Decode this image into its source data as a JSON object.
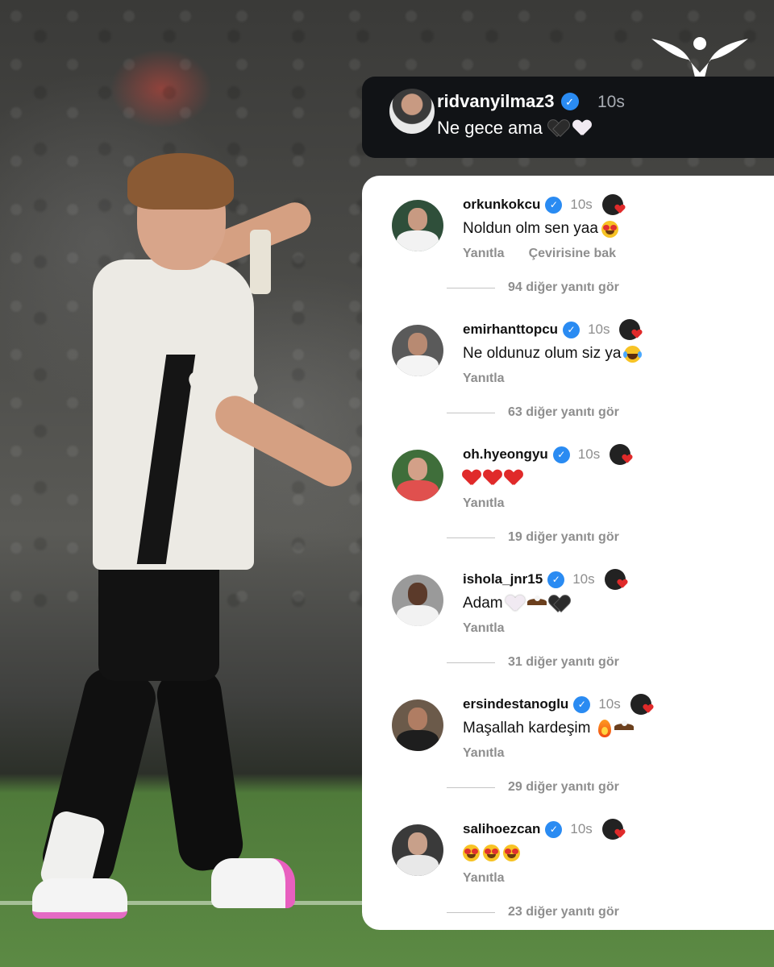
{
  "post": {
    "username": "ridvanyilmaz3",
    "time": "10s",
    "text": "Ne gece ama"
  },
  "actions": {
    "reply": "Yanıtla",
    "translate": "Çevirisine bak"
  },
  "comments": [
    {
      "username": "orkunkokcu",
      "time": "10s",
      "text": "Noldun olm sen yaa",
      "more": "94 diğer yanıtı gör",
      "avatar_colors": [
        "#c89a82",
        "#f2f2f2",
        "#2f4f3a"
      ]
    },
    {
      "username": "emirhanttopcu",
      "time": "10s",
      "text": "Ne oldunuz olum siz ya",
      "more": "63 diğer yanıtı gör",
      "avatar_colors": [
        "#b88a72",
        "#f4f4f4",
        "#5a5a5a"
      ]
    },
    {
      "username": "oh.hyeongyu",
      "time": "10s",
      "text": "",
      "more": "19 diğer yanıtı gör",
      "avatar_colors": [
        "#d3a088",
        "#e0504e",
        "#3f6e3a"
      ]
    },
    {
      "username": "ishola_jnr15",
      "time": "10s",
      "text": "Adam",
      "more": "31 diğer yanıtı gör",
      "avatar_colors": [
        "#5b3a2a",
        "#f2f2f2",
        "#9a9a9a"
      ]
    },
    {
      "username": "ersindestanoglu",
      "time": "10s",
      "text": "Maşallah kardeşim",
      "more": "29 diğer yanıtı gör",
      "avatar_colors": [
        "#b07d63",
        "#1e1e1e",
        "#6b5a4a"
      ]
    },
    {
      "username": "salihoezcan",
      "time": "10s",
      "text": "",
      "more": "23 diğer yanıtı gör",
      "avatar_colors": [
        "#c8a08a",
        "#1a1a1a",
        "#3a3a3a"
      ]
    }
  ],
  "colors": {
    "verified": "#2a8bf2",
    "muted": "#8e8e8e",
    "header_bg": "#111316",
    "panel_bg": "#ffffff"
  }
}
